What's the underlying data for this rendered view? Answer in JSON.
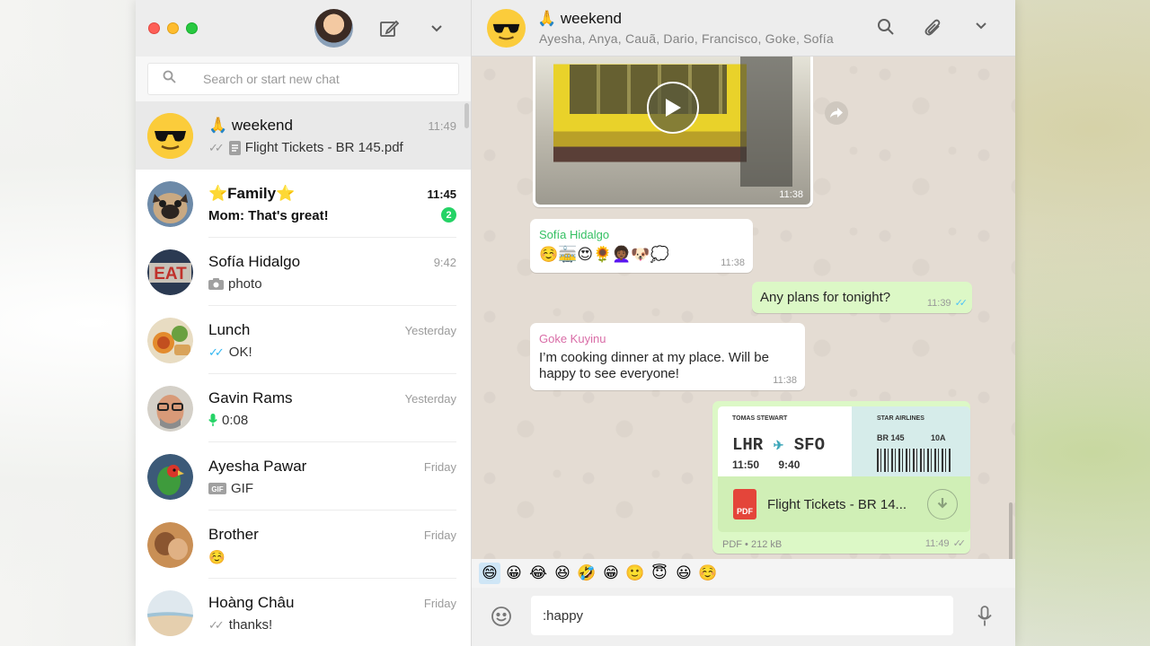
{
  "sidebar": {
    "search_placeholder": "Search or start new chat",
    "chats": [
      {
        "name": "🙏 weekend",
        "time": "11:49",
        "ticks": "✓✓",
        "preview_icon": "document-icon",
        "preview": "Flight Tickets - BR 145.pdf",
        "active": true
      },
      {
        "name": "⭐Family⭐",
        "time": "11:45",
        "preview": "Mom: That's great!",
        "unread": "2",
        "bold": true
      },
      {
        "name": "Sofía Hidalgo",
        "time": "9:42",
        "preview_icon": "camera-icon",
        "preview": "photo"
      },
      {
        "name": "Lunch",
        "time": "Yesterday",
        "ticks": "✓✓",
        "ticks_color": "#34b7f1",
        "preview": "OK!"
      },
      {
        "name": "Gavin Rams",
        "time": "Yesterday",
        "preview_icon": "mic-icon",
        "preview": "0:08"
      },
      {
        "name": "Ayesha Pawar",
        "time": "Friday",
        "preview_icon": "gif-icon",
        "preview": "GIF"
      },
      {
        "name": "Brother",
        "time": "Friday",
        "preview": "☺️"
      },
      {
        "name": "Hoàng Châu",
        "time": "Friday",
        "ticks": "✓✓",
        "preview": "thanks!"
      }
    ]
  },
  "conversation": {
    "title": "🙏 weekend",
    "members": "Ayesha, Anya, Cauã, Dario, Francisco, Goke, Sofía",
    "video_time": "11:38",
    "messages": [
      {
        "sender": "Sofía Hidalgo",
        "sender_color": "#35c063",
        "text": "☺️🚋😍🌻👩🏾‍🦱🐶💭",
        "time": "11:38"
      },
      {
        "out": true,
        "text": "Any plans for tonight?",
        "time": "11:39"
      },
      {
        "sender": "Goke Kuyinu",
        "sender_color": "#d96da7",
        "text_line1": "I’m cooking dinner at my place. Will be",
        "text_line2": "happy to see everyone!",
        "time": "11:38"
      }
    ],
    "ticket": {
      "passenger": "TOMAS STEWART",
      "airline": "STAR AIRLINES",
      "from": "LHR",
      "to": "SFO",
      "depart": "11:50",
      "arrive": "9:40",
      "flight": "BR 145",
      "seat": "10A",
      "file_name": "Flight Tickets - BR 14...",
      "file_type": "PDF",
      "file_meta": "PDF • 212 kB",
      "time": "11:49"
    },
    "emoji_suggestions": [
      "😄",
      "😀",
      "😂",
      "😆",
      "🤣",
      "😁",
      "🙂",
      "😇",
      "😃",
      "☺️"
    ],
    "composer_value": ":happy"
  },
  "colors": {
    "accent_green": "#25d366",
    "bubble_out": "#dcf8c6",
    "read_tick": "#34b7f1"
  }
}
